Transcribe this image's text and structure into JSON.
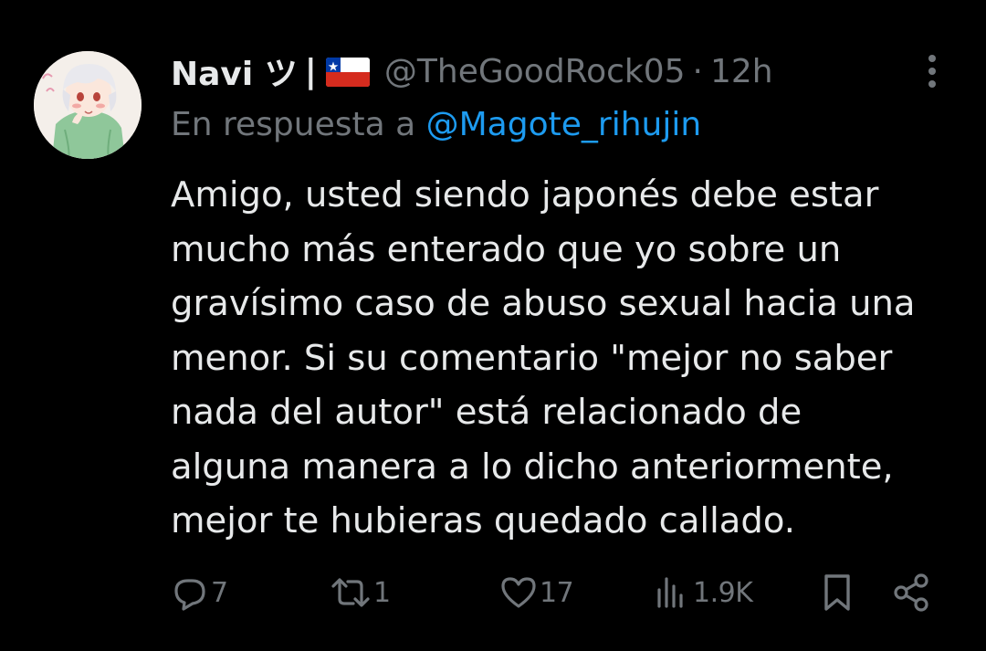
{
  "tweet": {
    "author": {
      "display_name": "Navi ツ",
      "separator": "|",
      "flag_icon": "chile-flag-icon",
      "handle": "@TheGoodRock05",
      "dot": "·",
      "time": "12h"
    },
    "reply": {
      "prefix": "En respuesta a",
      "to_handle": "@Magote_rihujin"
    },
    "text_lines": [
      "Amigo, usted siendo japonés debe estar",
      "mucho más enterado que yo sobre un",
      "gravísimo caso de abuso sexual hacia una",
      "menor. Si su comentario \"mejor no saber",
      "nada del autor\" está relacionado de",
      "alguna manera a lo dicho anteriormente,",
      "mejor te hubieras quedado callado."
    ],
    "actions": {
      "replies": {
        "icon": "reply-icon",
        "count": "7"
      },
      "reposts": {
        "icon": "repost-icon",
        "count": "1"
      },
      "likes": {
        "icon": "heart-icon",
        "count": "17"
      },
      "views": {
        "icon": "views-icon",
        "count": "1.9K"
      },
      "bookmark": {
        "icon": "bookmark-icon"
      },
      "share": {
        "icon": "share-icon"
      }
    }
  },
  "colors": {
    "background": "#000000",
    "primary_text": "#e7e9ea",
    "secondary_text": "#71767b",
    "link": "#1d9bf0"
  }
}
